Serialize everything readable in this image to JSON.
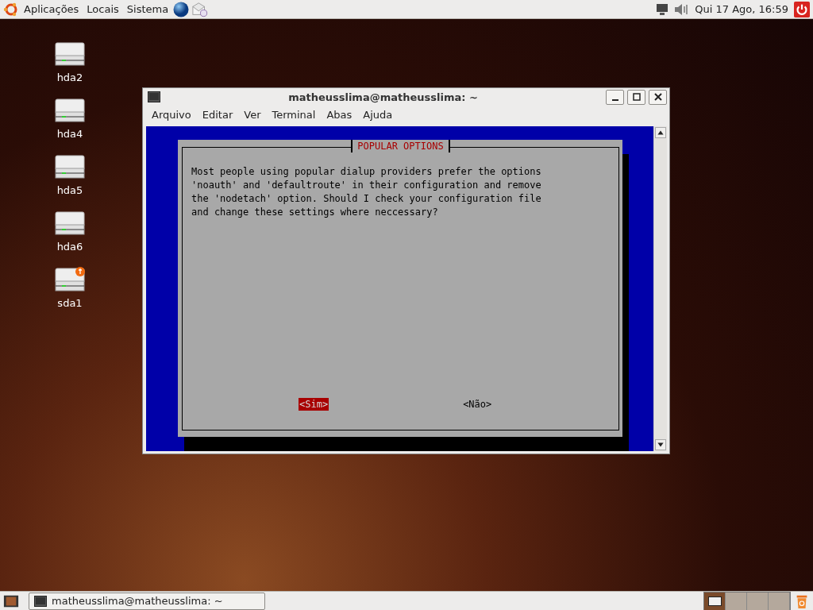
{
  "top_panel": {
    "menus": [
      "Aplicações",
      "Locais",
      "Sistema"
    ],
    "clock": "Qui 17 Ago, 16:59"
  },
  "desktop_icons": [
    {
      "label": "hda2",
      "kind": "drive"
    },
    {
      "label": "hda4",
      "kind": "drive"
    },
    {
      "label": "hda5",
      "kind": "drive"
    },
    {
      "label": "hda6",
      "kind": "drive"
    },
    {
      "label": "sda1",
      "kind": "usb"
    }
  ],
  "window": {
    "title": "matheusslima@matheusslima: ~",
    "menu": [
      "Arquivo",
      "Editar",
      "Ver",
      "Terminal",
      "Abas",
      "Ajuda"
    ],
    "dialog": {
      "title": "POPULAR OPTIONS",
      "lines": [
        "Most people using popular dialup providers prefer the options",
        "'noauth' and 'defaultroute' in their configuration and remove",
        "the 'nodetach' option. Should I check your configuration file",
        "and change these settings where neccessary?"
      ],
      "buttons": [
        {
          "label": "<Sim>",
          "selected": true
        },
        {
          "label": "<Não>",
          "selected": false
        }
      ]
    }
  },
  "taskbar": {
    "tasks": [
      {
        "label": "matheusslima@matheusslima: ~"
      }
    ],
    "workspaces": [
      {
        "selected": true
      },
      {
        "selected": false
      },
      {
        "selected": false
      },
      {
        "selected": false
      }
    ]
  }
}
